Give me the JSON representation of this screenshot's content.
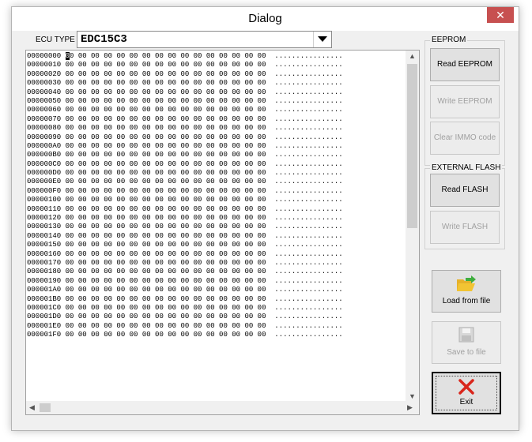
{
  "window": {
    "title": "Dialog",
    "close_glyph": "✕"
  },
  "ecu": {
    "label": "ECU TYPE",
    "value": "EDC15C3"
  },
  "hex_view": {
    "lines": [
      {
        "addr": "00000000",
        "cursor": "0",
        "bytes": "0 00 00 00 00 00 00 00 00 00 00 00 00 00 00 00",
        "ascii": "................"
      },
      {
        "addr": "00000010",
        "cursor": "",
        "bytes": "00 00 00 00 00 00 00 00 00 00 00 00 00 00 00 00",
        "ascii": "................"
      },
      {
        "addr": "00000020",
        "cursor": "",
        "bytes": "00 00 00 00 00 00 00 00 00 00 00 00 00 00 00 00",
        "ascii": "................"
      },
      {
        "addr": "00000030",
        "cursor": "",
        "bytes": "00 00 00 00 00 00 00 00 00 00 00 00 00 00 00 00",
        "ascii": "................"
      },
      {
        "addr": "00000040",
        "cursor": "",
        "bytes": "00 00 00 00 00 00 00 00 00 00 00 00 00 00 00 00",
        "ascii": "................"
      },
      {
        "addr": "00000050",
        "cursor": "",
        "bytes": "00 00 00 00 00 00 00 00 00 00 00 00 00 00 00 00",
        "ascii": "................"
      },
      {
        "addr": "00000060",
        "cursor": "",
        "bytes": "00 00 00 00 00 00 00 00 00 00 00 00 00 00 00 00",
        "ascii": "................"
      },
      {
        "addr": "00000070",
        "cursor": "",
        "bytes": "00 00 00 00 00 00 00 00 00 00 00 00 00 00 00 00",
        "ascii": "................"
      },
      {
        "addr": "00000080",
        "cursor": "",
        "bytes": "00 00 00 00 00 00 00 00 00 00 00 00 00 00 00 00",
        "ascii": "................"
      },
      {
        "addr": "00000090",
        "cursor": "",
        "bytes": "00 00 00 00 00 00 00 00 00 00 00 00 00 00 00 00",
        "ascii": "................"
      },
      {
        "addr": "000000A0",
        "cursor": "",
        "bytes": "00 00 00 00 00 00 00 00 00 00 00 00 00 00 00 00",
        "ascii": "................"
      },
      {
        "addr": "000000B0",
        "cursor": "",
        "bytes": "00 00 00 00 00 00 00 00 00 00 00 00 00 00 00 00",
        "ascii": "................"
      },
      {
        "addr": "000000C0",
        "cursor": "",
        "bytes": "00 00 00 00 00 00 00 00 00 00 00 00 00 00 00 00",
        "ascii": "................"
      },
      {
        "addr": "000000D0",
        "cursor": "",
        "bytes": "00 00 00 00 00 00 00 00 00 00 00 00 00 00 00 00",
        "ascii": "................"
      },
      {
        "addr": "000000E0",
        "cursor": "",
        "bytes": "00 00 00 00 00 00 00 00 00 00 00 00 00 00 00 00",
        "ascii": "................"
      },
      {
        "addr": "000000F0",
        "cursor": "",
        "bytes": "00 00 00 00 00 00 00 00 00 00 00 00 00 00 00 00",
        "ascii": "................"
      },
      {
        "addr": "00000100",
        "cursor": "",
        "bytes": "00 00 00 00 00 00 00 00 00 00 00 00 00 00 00 00",
        "ascii": "................"
      },
      {
        "addr": "00000110",
        "cursor": "",
        "bytes": "00 00 00 00 00 00 00 00 00 00 00 00 00 00 00 00",
        "ascii": "................"
      },
      {
        "addr": "00000120",
        "cursor": "",
        "bytes": "00 00 00 00 00 00 00 00 00 00 00 00 00 00 00 00",
        "ascii": "................"
      },
      {
        "addr": "00000130",
        "cursor": "",
        "bytes": "00 00 00 00 00 00 00 00 00 00 00 00 00 00 00 00",
        "ascii": "................"
      },
      {
        "addr": "00000140",
        "cursor": "",
        "bytes": "00 00 00 00 00 00 00 00 00 00 00 00 00 00 00 00",
        "ascii": "................"
      },
      {
        "addr": "00000150",
        "cursor": "",
        "bytes": "00 00 00 00 00 00 00 00 00 00 00 00 00 00 00 00",
        "ascii": "................"
      },
      {
        "addr": "00000160",
        "cursor": "",
        "bytes": "00 00 00 00 00 00 00 00 00 00 00 00 00 00 00 00",
        "ascii": "................"
      },
      {
        "addr": "00000170",
        "cursor": "",
        "bytes": "00 00 00 00 00 00 00 00 00 00 00 00 00 00 00 00",
        "ascii": "................"
      },
      {
        "addr": "00000180",
        "cursor": "",
        "bytes": "00 00 00 00 00 00 00 00 00 00 00 00 00 00 00 00",
        "ascii": "................"
      },
      {
        "addr": "00000190",
        "cursor": "",
        "bytes": "00 00 00 00 00 00 00 00 00 00 00 00 00 00 00 00",
        "ascii": "................"
      },
      {
        "addr": "000001A0",
        "cursor": "",
        "bytes": "00 00 00 00 00 00 00 00 00 00 00 00 00 00 00 00",
        "ascii": "................"
      },
      {
        "addr": "000001B0",
        "cursor": "",
        "bytes": "00 00 00 00 00 00 00 00 00 00 00 00 00 00 00 00",
        "ascii": "................"
      },
      {
        "addr": "000001C0",
        "cursor": "",
        "bytes": "00 00 00 00 00 00 00 00 00 00 00 00 00 00 00 00",
        "ascii": "................"
      },
      {
        "addr": "000001D0",
        "cursor": "",
        "bytes": "00 00 00 00 00 00 00 00 00 00 00 00 00 00 00 00",
        "ascii": "................"
      },
      {
        "addr": "000001E0",
        "cursor": "",
        "bytes": "00 00 00 00 00 00 00 00 00 00 00 00 00 00 00 00",
        "ascii": "................"
      },
      {
        "addr": "000001F0",
        "cursor": "",
        "bytes": "00 00 00 00 00 00 00 00 00 00 00 00 00 00 00 00",
        "ascii": "................"
      }
    ]
  },
  "eeprom": {
    "group_label": "EEPROM",
    "read_label": "Read EEPROM",
    "write_label": "Write EEPROM",
    "clear_label": "Clear IMMO code"
  },
  "flash": {
    "group_label": "EXTERNAL FLASH",
    "read_label": "Read FLASH",
    "write_label": "Write FLASH"
  },
  "file": {
    "load_label": "Load from file",
    "save_label": "Save to file",
    "load_icon": "folder-open-icon",
    "save_icon": "floppy-disk-icon"
  },
  "exit": {
    "label": "Exit",
    "icon": "red-x-icon"
  },
  "colors": {
    "close_button": "#c75050",
    "exit_x": "#d9261c",
    "folder": "#f2c433",
    "arrow": "#3fae3f"
  }
}
